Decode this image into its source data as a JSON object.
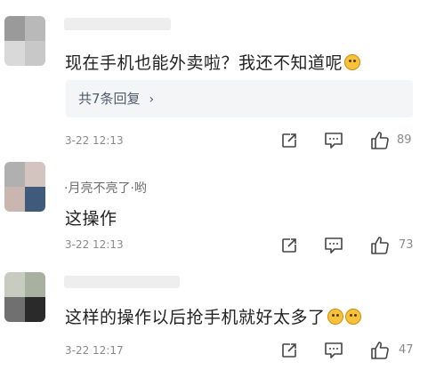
{
  "comments": [
    {
      "username": "",
      "text": "现在手机也能外卖啦？我还不知道呢",
      "emoji": "laughing-emoji",
      "replies_label": "共7条回复",
      "time": "3-22 12:13",
      "likes": "89",
      "avatar_colors": [
        "#9a9a9a",
        "#b9b9b9",
        "#d9d9d9",
        "#c8c8c8"
      ]
    },
    {
      "username": "·月亮不亮了·哟",
      "text": "这操作",
      "time": "3-22 12:13",
      "likes": "73",
      "avatar_colors": [
        "#b0b0b0",
        "#d4c4c0",
        "#c9b6b0",
        "#3f5a7a"
      ]
    },
    {
      "username": "",
      "text": "这样的操作以后抢手机就好太多了",
      "emoji": "grinning-cat-emoji",
      "time": "3-22 12:17",
      "likes": "47",
      "avatar_colors": [
        "#c8ccc0",
        "#a8b0a0",
        "#707070",
        "#2a2a2a"
      ]
    }
  ],
  "icons": {
    "share": "share-icon",
    "comment": "comment-icon",
    "like": "like-icon"
  },
  "colors": {
    "text": "#222222",
    "meta": "#8a8a8a",
    "reply_bg": "#f4f5f7",
    "emoji": "#f7c23c"
  }
}
